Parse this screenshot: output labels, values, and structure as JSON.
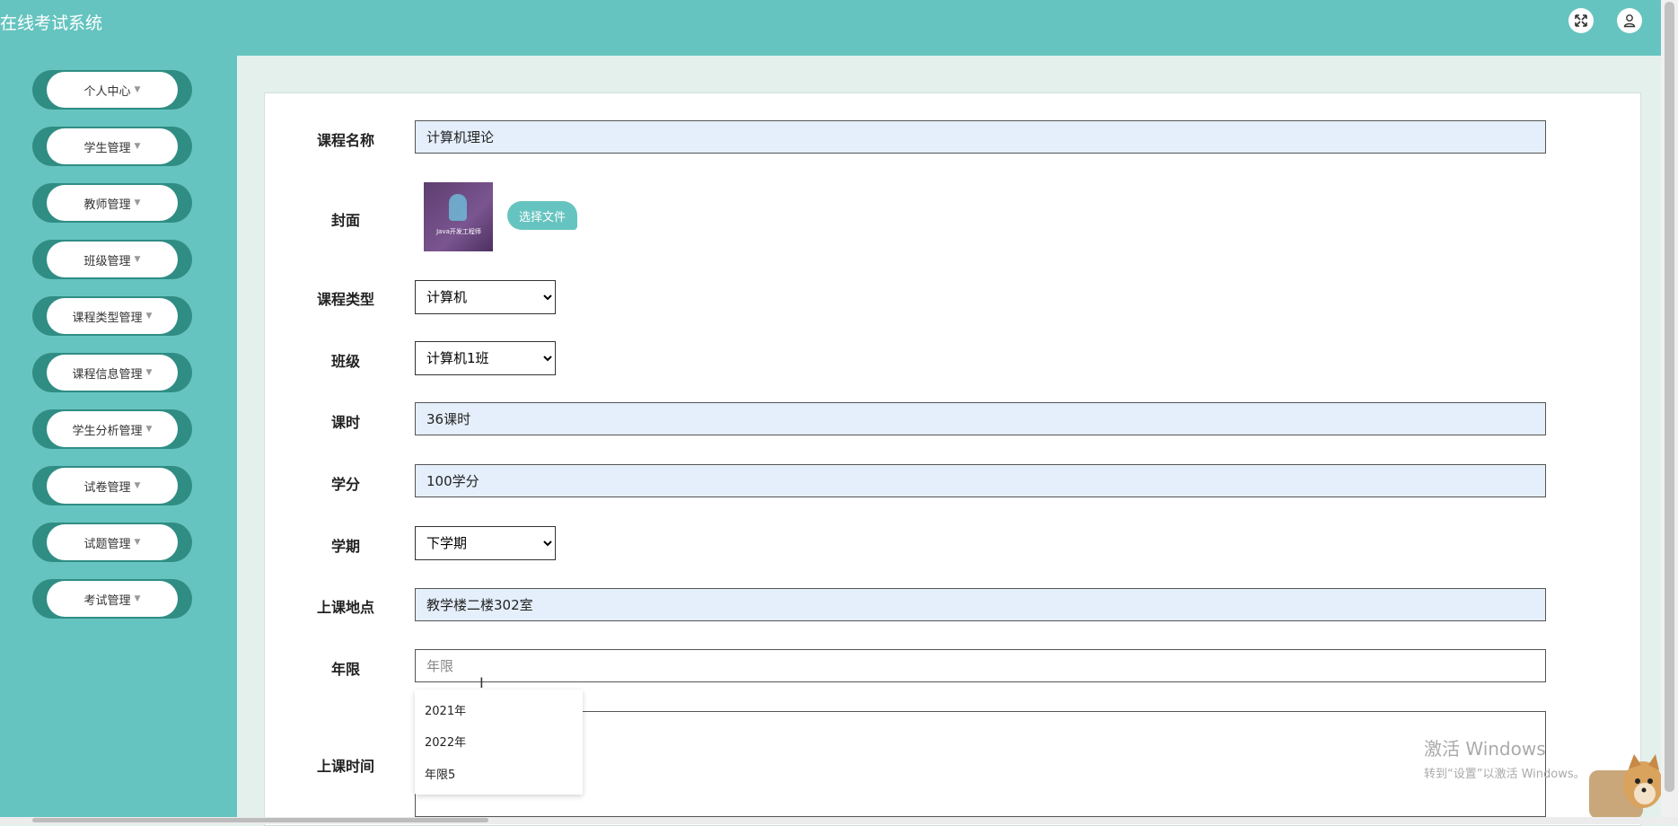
{
  "app": {
    "title": "在线考试系统"
  },
  "header": {
    "fullscreen_icon": "expand-icon",
    "user_icon": "user-icon"
  },
  "sidebar": {
    "items": [
      {
        "label": "个人中心"
      },
      {
        "label": "学生管理"
      },
      {
        "label": "教师管理"
      },
      {
        "label": "班级管理"
      },
      {
        "label": "课程类型管理"
      },
      {
        "label": "课程信息管理"
      },
      {
        "label": "学生分析管理"
      },
      {
        "label": "试卷管理"
      },
      {
        "label": "试题管理"
      },
      {
        "label": "考试管理"
      }
    ]
  },
  "form": {
    "course_name": {
      "label": "课程名称",
      "value": "计算机理论"
    },
    "cover": {
      "label": "封面",
      "image_text": "Java开发工程师",
      "choose_file_label": "选择文件"
    },
    "course_type": {
      "label": "课程类型",
      "value": "计算机"
    },
    "class": {
      "label": "班级",
      "value": "计算机1班"
    },
    "hours": {
      "label": "课时",
      "value": "36课时"
    },
    "credits": {
      "label": "学分",
      "value": "100学分"
    },
    "semester": {
      "label": "学期",
      "value": "下学期"
    },
    "location": {
      "label": "上课地点",
      "value": "教学楼二楼302室"
    },
    "years": {
      "label": "年限",
      "placeholder": "年限"
    },
    "class_time": {
      "label": "上课时间"
    }
  },
  "dropdown": {
    "options": [
      "2021年",
      "2022年",
      "年限5"
    ]
  },
  "watermark": {
    "line1": "激活 Windows",
    "line2": "转到“设置”以激活 Windows。"
  },
  "colors": {
    "primary": "#66c4c0",
    "menu_dark": "#2f8d84",
    "input_bg": "#e4effb"
  }
}
